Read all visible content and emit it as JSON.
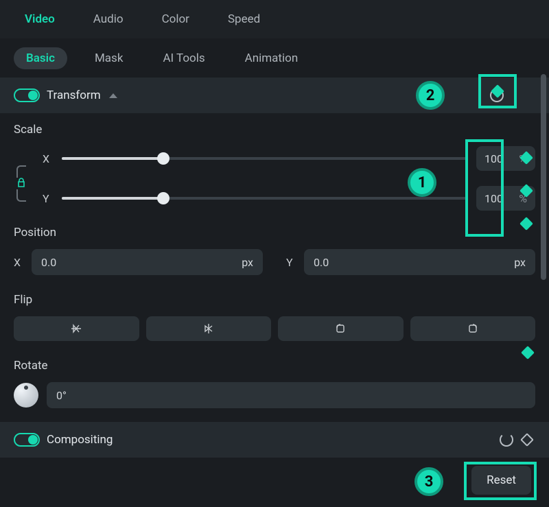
{
  "mainTabs": {
    "video": "Video",
    "audio": "Audio",
    "color": "Color",
    "speed": "Speed"
  },
  "subTabs": {
    "basic": "Basic",
    "mask": "Mask",
    "aiTools": "AI Tools",
    "animation": "Animation"
  },
  "sections": {
    "transform": {
      "title": "Transform",
      "scaleLabel": "Scale",
      "scale": {
        "xLabel": "X",
        "yLabel": "Y",
        "xValue": "100",
        "yValue": "100",
        "unit": "%",
        "sliderPercent": 25
      },
      "positionLabel": "Position",
      "position": {
        "xLabel": "X",
        "yLabel": "Y",
        "xValue": "0.0",
        "yValue": "0.0",
        "unit": "px"
      },
      "flipLabel": "Flip",
      "rotateLabel": "Rotate",
      "rotate": {
        "value": "0°"
      }
    },
    "compositing": {
      "title": "Compositing"
    }
  },
  "footer": {
    "reset": "Reset"
  },
  "annotations": {
    "c1": "1",
    "c2": "2",
    "c3": "3"
  },
  "colors": {
    "accent": "#17d9b0",
    "highlight": "#16dcb4"
  }
}
